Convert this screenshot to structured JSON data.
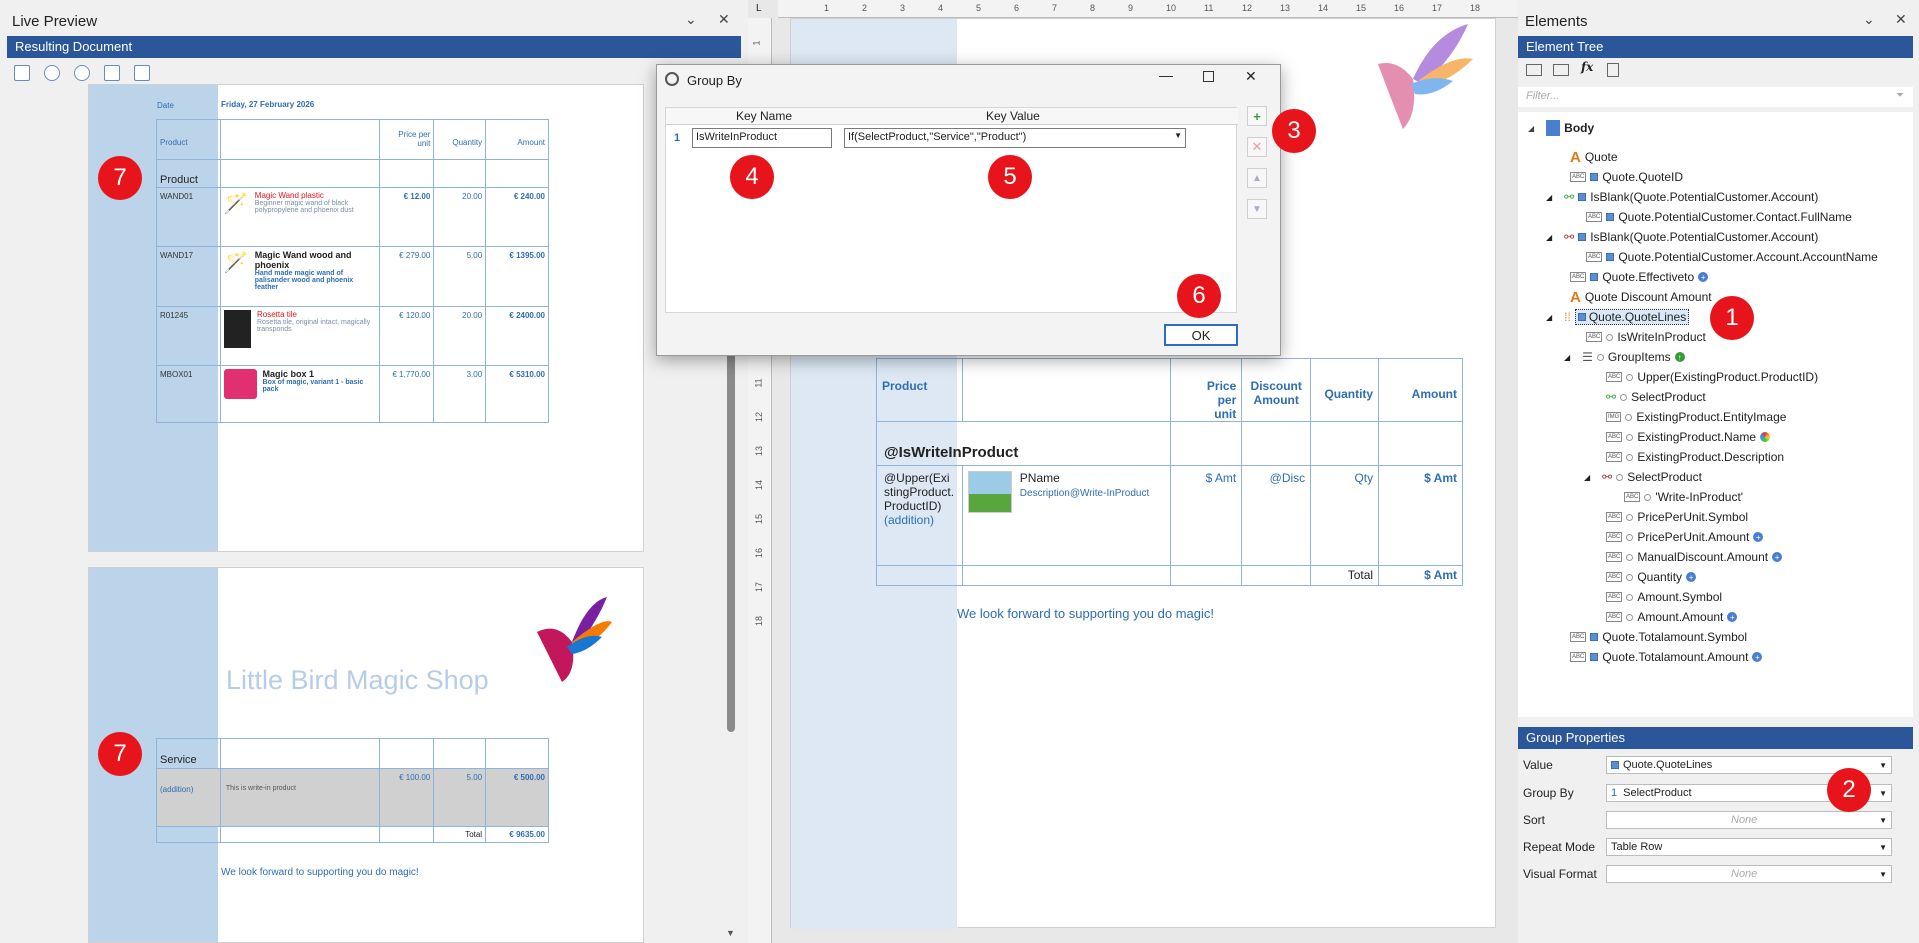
{
  "left": {
    "title": "Live Preview",
    "subtitle": "Resulting Document",
    "page1": {
      "date_label": "Date",
      "date_value": "Friday, 27 February 2026",
      "headers": [
        "Product",
        "Price per unit",
        "Quantity",
        "Amount"
      ],
      "group": "Product",
      "rows": [
        {
          "id": "WAND01",
          "name": "Magic Wand plastic",
          "desc": "Beginner magic wand of black polypropylene and phoenix dust",
          "price": "€ 12.00",
          "qty": "20.00",
          "amount": "€ 240.00"
        },
        {
          "id": "WAND17",
          "name": "Magic Wand wood and phoenix",
          "desc": "Hand made magic wand of palisander wood and phoenix feather",
          "price": "€ 279.00",
          "qty": "5.00",
          "amount": "€ 1395.00"
        },
        {
          "id": "R01245",
          "name": "Rosetta tile",
          "desc": "Rosetta tile, original intact, magically transponds",
          "price": "€ 120.00",
          "qty": "20.00",
          "amount": "€ 2400.00"
        },
        {
          "id": "MBOX01",
          "name": "Magic box 1",
          "desc": "Box of magic, variant 1 - basic pack",
          "price": "€ 1,770.00",
          "qty": "3.00",
          "amount": "€ 5310.00"
        }
      ]
    },
    "page2": {
      "shop_name": "Little Bird Magic Shop",
      "group": "Service",
      "row_id": "(addition)",
      "row_desc": "This is write-in product",
      "row_price": "€ 100.00",
      "row_qty": "5.00",
      "row_amount": "€ 500.00",
      "total_label": "Total",
      "total_value": "€ 9635.00",
      "footer": "We look forward to supporting you do magic!"
    }
  },
  "dialog": {
    "title": "Group By",
    "col_key_name": "Key Name",
    "col_key_value": "Key Value",
    "row_num": "1",
    "key_name": "IsWriteInProduct",
    "key_value": "If(SelectProduct,\"Service\",\"Product\")",
    "ok": "OK"
  },
  "center": {
    "headers": [
      "Product",
      "Price per unit",
      "Discount Amount",
      "Quantity",
      "Amount"
    ],
    "group_placeholder": "@IsWriteInProduct",
    "id_placeholder": "@Upper(ExistingProduct.ProductID)",
    "addition": "(addition)",
    "pname": "PName",
    "desc": "Description@Write-InProduct",
    "amt": "$ Amt",
    "disc": "@Disc",
    "qty": "Qty",
    "amt2": "$ Amt",
    "total_label": "Total",
    "total_value": "$ Amt",
    "footer": "We look forward to supporting you do magic!",
    "ruler_numbers": [
      "1",
      "2",
      "3",
      "4",
      "5",
      "6",
      "7",
      "8",
      "9",
      "10",
      "11",
      "12",
      "13",
      "14",
      "15",
      "16",
      "17",
      "18"
    ]
  },
  "right": {
    "title": "Elements",
    "subtitle": "Element Tree",
    "filter_placeholder": "Filter...",
    "tree": [
      "Body",
      "Quote",
      "Quote.QuoteID",
      "IsBlank(Quote.PotentialCustomer.Account)",
      "Quote.PotentialCustomer.Contact.FullName",
      "IsBlank(Quote.PotentialCustomer.Account)",
      "Quote.PotentialCustomer.Account.AccountName",
      "Quote.Effectiveto",
      "Quote Discount Amount",
      "Quote.QuoteLines",
      "IsWriteInProduct",
      "GroupItems",
      "Upper(ExistingProduct.ProductID)",
      "SelectProduct",
      "ExistingProduct.EntityImage",
      "ExistingProduct.Name",
      "ExistingProduct.Description",
      "SelectProduct",
      "'Write-InProduct'",
      "PricePerUnit.Symbol",
      "PricePerUnit.Amount",
      "ManualDiscount.Amount",
      "Quantity",
      "Amount.Symbol",
      "Amount.Amount",
      "Quote.Totalamount.Symbol",
      "Quote.Totalamount.Amount"
    ],
    "props_title": "Group Properties",
    "props": {
      "value_label": "Value",
      "value": "Quote.QuoteLines",
      "groupby_label": "Group By",
      "groupby_num": "1",
      "groupby": "SelectProduct",
      "sort_label": "Sort",
      "sort": "None",
      "repeat_label": "Repeat Mode",
      "repeat": "Table Row",
      "visual_label": "Visual Format",
      "visual": "None"
    }
  },
  "badges": [
    "1",
    "2",
    "3",
    "4",
    "5",
    "6",
    "7",
    "7"
  ]
}
